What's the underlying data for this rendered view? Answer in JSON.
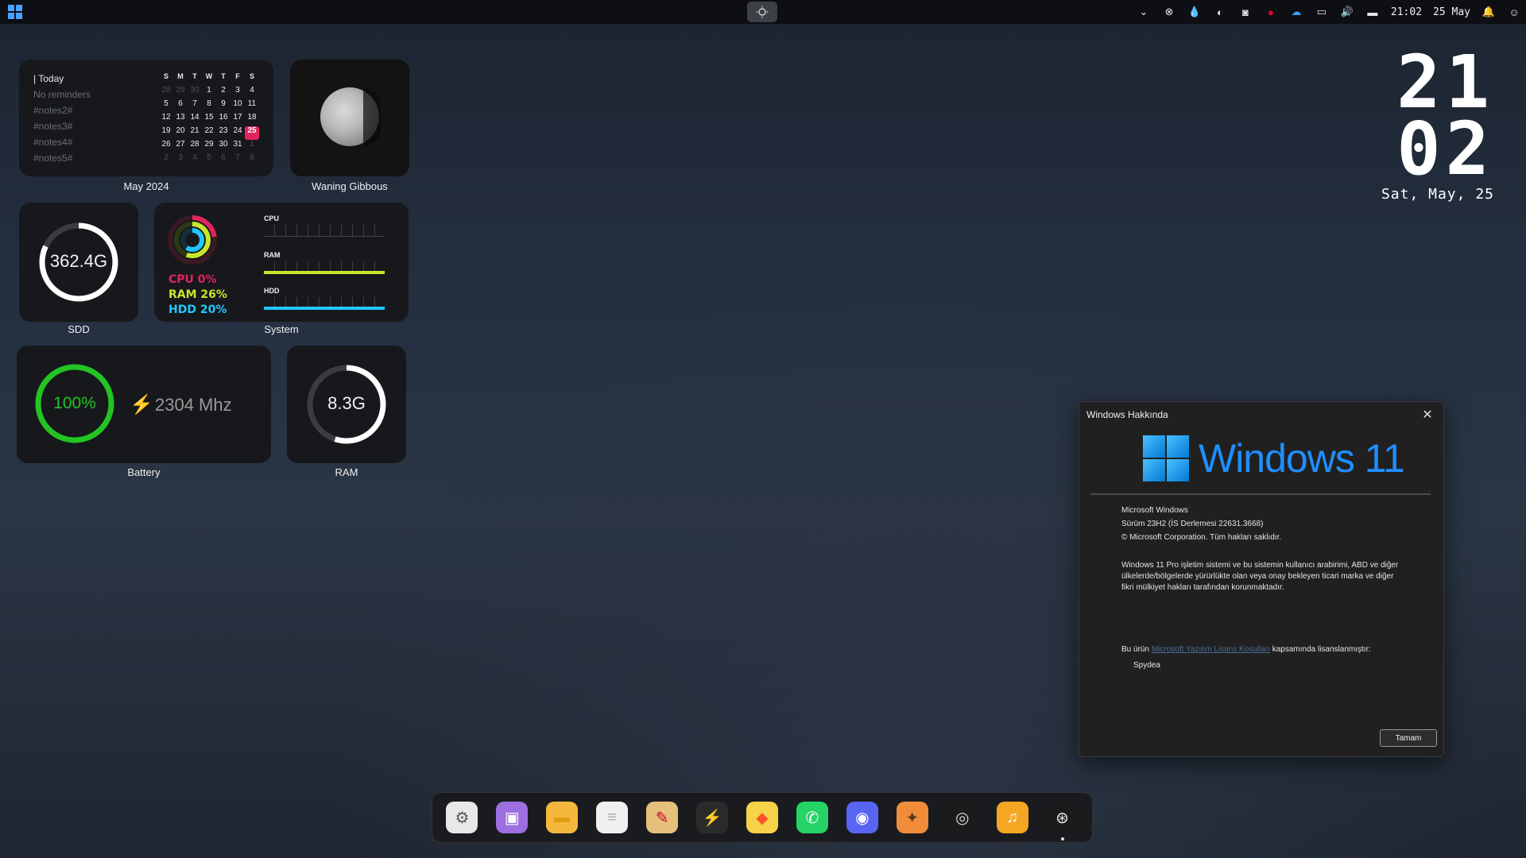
{
  "topbar": {
    "tray_time": "21:02",
    "tray_date": "25 May"
  },
  "calendar": {
    "today_label": "| Today",
    "reminders": "No reminders",
    "notes": [
      "#notes2#",
      "#notes3#",
      "#notes4#",
      "#notes5#"
    ],
    "weekdays": [
      "S",
      "M",
      "T",
      "W",
      "T",
      "F",
      "S"
    ],
    "rows": [
      [
        "28",
        "29",
        "30",
        "1",
        "2",
        "3",
        "4"
      ],
      [
        "5",
        "6",
        "7",
        "8",
        "9",
        "10",
        "11"
      ],
      [
        "12",
        "13",
        "14",
        "15",
        "16",
        "17",
        "18"
      ],
      [
        "19",
        "20",
        "21",
        "22",
        "23",
        "24",
        "25"
      ],
      [
        "26",
        "27",
        "28",
        "29",
        "30",
        "31",
        "1"
      ],
      [
        "2",
        "3",
        "4",
        "5",
        "6",
        "7",
        "8"
      ]
    ],
    "selected_day": "25",
    "caption": "May 2024"
  },
  "moon": {
    "caption": "Waning Gibbous"
  },
  "ssd": {
    "value": "362.4G",
    "fill": 0.82,
    "caption": "SDD"
  },
  "system": {
    "cpu_text": "CPU 0%",
    "ram_text": "RAM 26%",
    "hdd_text": "HDD 20%",
    "cpu_label": "CPU",
    "ram_label": "RAM",
    "hdd_label": "HDD",
    "cpu_value": 0,
    "ram_value": 26,
    "hdd_value": 20,
    "caption": "System",
    "colors": {
      "cpu": "#e0245e",
      "ram": "#c8e62a",
      "hdd": "#1ec8ff"
    }
  },
  "battery": {
    "value": "100%",
    "fill": 1.0,
    "mhz": "2304 Mhz",
    "caption": "Battery",
    "color": "#23c423"
  },
  "ram": {
    "value": "8.3G",
    "fill": 0.55,
    "caption": "RAM"
  },
  "bigclock": {
    "hours": "21",
    "minutes": "02",
    "date": "Sat, May, 25"
  },
  "about": {
    "title": "Windows Hakkında",
    "brand": "Windows 11",
    "line1": "Microsoft Windows",
    "line2": "Sürüm 23H2 (İS Derlemesi 22631.3668)",
    "line3": "© Microsoft Corporation. Tüm hakları saklıdır.",
    "paragraph": "Windows 11 Pro işletim sistemi ve bu sistemin kullanıcı arabirimi, ABD ve diğer ülkelerde/bölgelerde yürürlükte olan veya onay bekleyen ticari marka ve diğer fikri mülkiyet hakları tarafından korunmaktadır.",
    "license_prefix": "Bu ürün ",
    "license_link": "Microsoft Yazılım Lisans Koşulları",
    "license_suffix": " kapsamında lisanslanmıştır:",
    "user": "Spydea",
    "ok_label": "Tamam"
  },
  "dock": {
    "apps": [
      {
        "name": "settings-icon",
        "glyph": "⚙",
        "bg": "#e8e8e8",
        "fg": "#555"
      },
      {
        "name": "store-icon",
        "glyph": "▣",
        "bg": "#9b6fe0",
        "fg": "#fff"
      },
      {
        "name": "folder-icon",
        "glyph": "▬",
        "bg": "#f5b83d",
        "fg": "#e29c12"
      },
      {
        "name": "notepad-icon",
        "glyph": "≡",
        "bg": "#f0f0f0",
        "fg": "#aaa"
      },
      {
        "name": "paint-icon",
        "glyph": "✎",
        "bg": "#e5c07b",
        "fg": "#c03"
      },
      {
        "name": "terminal-icon",
        "glyph": "⚡",
        "bg": "#2b2b2b",
        "fg": "#f5c518"
      },
      {
        "name": "brave-icon",
        "glyph": "◆",
        "bg": "#f7d34a",
        "fg": "#fb542b"
      },
      {
        "name": "whatsapp-icon",
        "glyph": "✆",
        "bg": "#25d366",
        "fg": "#fff"
      },
      {
        "name": "discord-icon",
        "glyph": "◉",
        "bg": "#5865f2",
        "fg": "#fff"
      },
      {
        "name": "gimp-icon",
        "glyph": "✦",
        "bg": "#f08c3a",
        "fg": "#5a3a1a"
      },
      {
        "name": "obs-icon",
        "glyph": "◎",
        "bg": "#1b1b1b",
        "fg": "#ddd"
      },
      {
        "name": "music-icon",
        "glyph": "♫",
        "bg": "#f5a623",
        "fg": "#fff"
      },
      {
        "name": "steam-icon",
        "glyph": "⊛",
        "bg": "#1b1b1b",
        "fg": "#eee"
      }
    ]
  }
}
